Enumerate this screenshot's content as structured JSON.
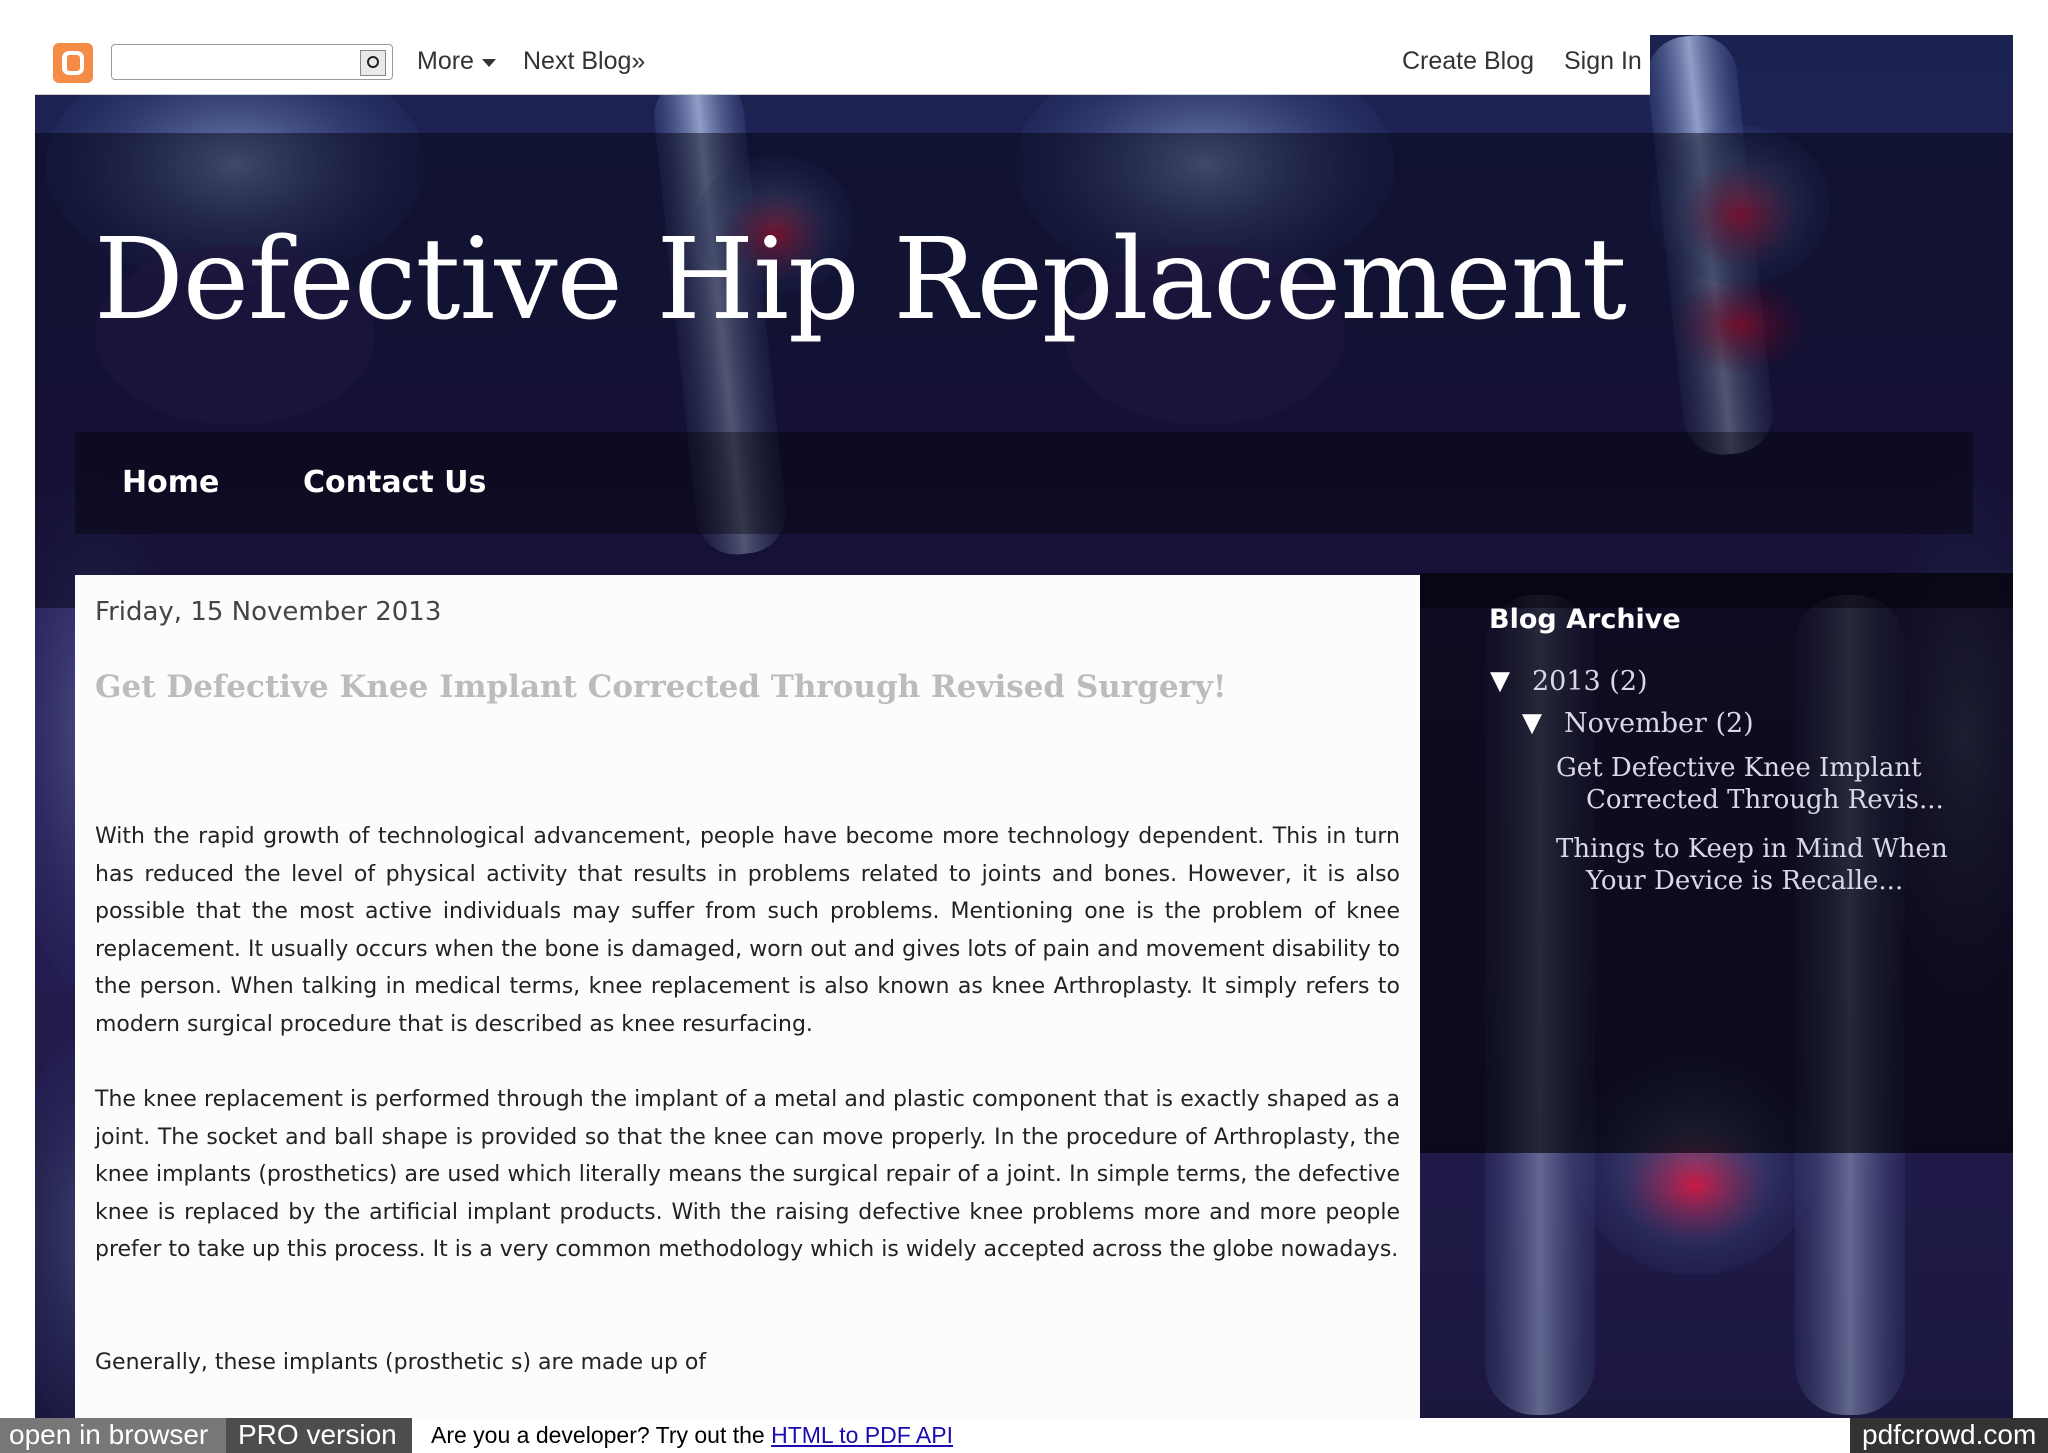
{
  "navbar": {
    "logo_icon": "blogger-icon",
    "search_placeholder": "",
    "more_label": "More",
    "next_blog_label": "Next Blog»",
    "create_blog_label": "Create Blog",
    "sign_in_label": "Sign In"
  },
  "header": {
    "title": "Defective Hip Replacement"
  },
  "tabs": [
    {
      "label": "Home"
    },
    {
      "label": "Contact Us"
    }
  ],
  "post": {
    "date": "Friday, 15 November 2013",
    "title": "Get Defective Knee Implant Corrected Through Revised Surgery!",
    "paragraphs": [
      "With the rapid growth of technological advancement, people have become more technology dependent. This in turn has reduced the level of physical activity that results in problems related to joints and bones. However, it is also possible that the most active individuals may suffer from such problems. Mentioning one is the problem of knee replacement. It usually occurs when the bone is damaged, worn out and gives lots of pain and movement disability to the person. When talking in medical terms, knee replacement is also known as knee Arthroplasty. It simply refers to modern surgical procedure that is described as knee resurfacing.",
      "The knee replacement is performed through the implant of a metal and plastic component that is exactly shaped as a joint. The socket and ball shape is provided so that the knee can move properly. In the procedure of Arthroplasty, the knee implants (prosthetics) are used which literally means the surgical repair of a joint. In simple terms, the defective knee is replaced by the artificial implant products. With the raising defective knee problems more and more people prefer to take up this process. It is a very common methodology which is widely accepted across the globe nowadays.",
      "Generally, these implants (prosthetic s) are made up of"
    ]
  },
  "sidebar": {
    "archive_heading": "Blog Archive",
    "toggle_symbol": "▼",
    "year": "2013 (2)",
    "month": "November (2)",
    "posts": [
      "Get Defective Knee Implant Corrected Through Revis...",
      "Things to Keep in Mind When Your Device is Recalle..."
    ]
  },
  "footer": {
    "open_in_browser": "open in browser",
    "pro_version": "PRO version",
    "developer_text": "Are you a developer? Try out the ",
    "api_link": "HTML to PDF API",
    "brand": "pdfcrowd.com"
  },
  "colors": {
    "background_purple": "#2a1f5a",
    "title_text": "#ffffff",
    "post_title_gray": "#bcbcbc",
    "blogger_orange": "#f58c46",
    "link_blue": "#1a0dab"
  }
}
